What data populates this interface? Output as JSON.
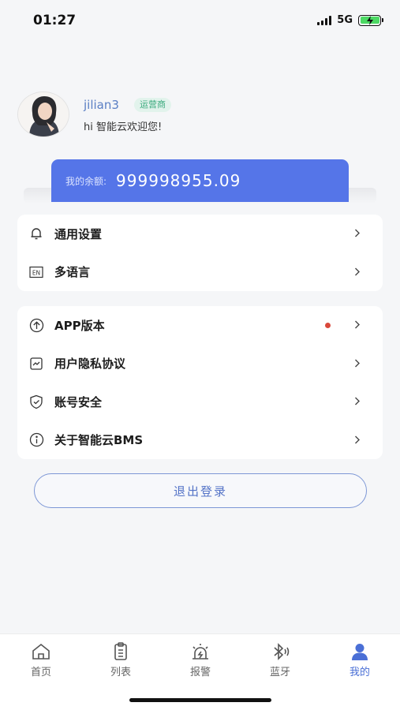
{
  "status_bar": {
    "time": "01:27",
    "network": "5G"
  },
  "profile": {
    "username": "jilian3",
    "role": "运营商",
    "welcome": "hi 智能云欢迎您!"
  },
  "balance": {
    "label": "我的余额:",
    "value": "999998955.09"
  },
  "settings_group": [
    {
      "label": "通用设置",
      "icon": "bell-icon"
    },
    {
      "label": "多语言",
      "icon": "language-en-icon"
    }
  ],
  "info_group": [
    {
      "label": "APP版本",
      "icon": "upload-arrow-icon",
      "badge": "red-dot"
    },
    {
      "label": "用户隐私协议",
      "icon": "document-icon"
    },
    {
      "label": "账号安全",
      "icon": "shield-icon"
    },
    {
      "label": "关于智能云BMS",
      "icon": "info-icon"
    }
  ],
  "logout_label": "退出登录",
  "tabs": [
    {
      "label": "首页",
      "icon": "home-icon",
      "active": false
    },
    {
      "label": "列表",
      "icon": "clipboard-icon",
      "active": false
    },
    {
      "label": "报警",
      "icon": "alarm-icon",
      "active": false
    },
    {
      "label": "蓝牙",
      "icon": "bluetooth-icon",
      "active": false
    },
    {
      "label": "我的",
      "icon": "user-icon",
      "active": true
    }
  ],
  "colors": {
    "accent": "#5575e8",
    "tab_active": "#4a6fd6",
    "badge_bg": "#e2f3ec",
    "badge_text": "#3aaa7d",
    "red_dot": "#d9483b"
  }
}
